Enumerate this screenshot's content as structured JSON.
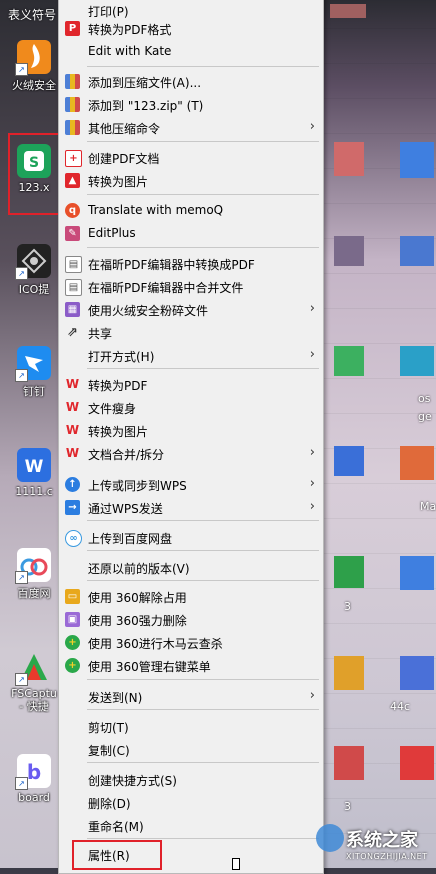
{
  "desktop": {
    "top_label": "表义符号",
    "icons": [
      {
        "label": "火绒安全",
        "icon": "huorong-icon",
        "color": "#f08a1c"
      },
      {
        "label": "123.x",
        "icon": "wps-sheet-icon",
        "color": "#1da35a"
      },
      {
        "label": "ICO提",
        "icon": "ico-tool-icon",
        "color": "#222222"
      },
      {
        "label": "钉钉",
        "icon": "dingtalk-icon",
        "color": "#1e8cf0"
      },
      {
        "label": "1111.c",
        "icon": "wps-writer-icon",
        "color": "#2c6fe0"
      },
      {
        "label": "百度网",
        "icon": "baidu-netdisk-icon",
        "color": "#ffffff"
      },
      {
        "label": "FSCaptu\n- 快捷",
        "icon": "fscapture-icon",
        "color": "#e83a2c"
      },
      {
        "label": "board",
        "icon": "board-icon",
        "color": "#6a5cf0"
      }
    ],
    "right_labels": [
      "os",
      "ge",
      "Ma",
      "3",
      "44c",
      "3"
    ]
  },
  "menu": {
    "items": [
      {
        "label": "打印(P)",
        "icon": "",
        "arrow": false
      },
      {
        "label": "转换为PDF格式",
        "icon": "pdf-convert-icon",
        "color": "#e0262c",
        "arrow": false
      },
      {
        "label": "Edit with Kate",
        "icon": "",
        "arrow": false
      },
      {
        "label": "添加到压缩文件(A)...",
        "icon": "archive-icon",
        "color": "#4d7fd6",
        "arrow": false
      },
      {
        "label": "添加到 \"123.zip\" (T)",
        "icon": "archive-icon",
        "color": "#4d7fd6",
        "arrow": false
      },
      {
        "label": "其他压缩命令",
        "icon": "archive-icon",
        "color": "#4d7fd6",
        "arrow": true
      },
      {
        "label": "创建PDF文档",
        "icon": "pdf-create-icon",
        "color": "#e0262c",
        "arrow": false
      },
      {
        "label": "转换为图片",
        "icon": "image-convert-icon",
        "color": "#e0262c",
        "arrow": false
      },
      {
        "label": "Translate with memoQ",
        "icon": "memoq-icon",
        "color": "#e8502a",
        "arrow": false
      },
      {
        "label": "EditPlus",
        "icon": "editplus-icon",
        "color": "#c94a7a",
        "arrow": false
      },
      {
        "label": "在福昕PDF编辑器中转换成PDF",
        "icon": "foxit-icon",
        "color": "#6a6a6a",
        "arrow": false
      },
      {
        "label": "在福昕PDF编辑器中合并文件",
        "icon": "foxit-icon",
        "color": "#6a6a6a",
        "arrow": false
      },
      {
        "label": "使用火绒安全粉碎文件",
        "icon": "shredder-icon",
        "color": "#8b5cc8",
        "arrow": true
      },
      {
        "label": "共享",
        "icon": "share-icon",
        "color": "#333333",
        "arrow": false
      },
      {
        "label": "打开方式(H)",
        "icon": "",
        "arrow": true
      },
      {
        "label": "转换为PDF",
        "icon": "wps-icon",
        "color": "#e0262c",
        "arrow": false
      },
      {
        "label": "文件瘦身",
        "icon": "wps-icon",
        "color": "#e0262c",
        "arrow": false
      },
      {
        "label": "转换为图片",
        "icon": "wps-icon",
        "color": "#e0262c",
        "arrow": false
      },
      {
        "label": "文档合并/拆分",
        "icon": "wps-icon",
        "color": "#e0262c",
        "arrow": true
      },
      {
        "label": "上传或同步到WPS",
        "icon": "cloud-upload-icon",
        "color": "#2b7de0",
        "arrow": true
      },
      {
        "label": "通过WPS发送",
        "icon": "send-icon",
        "color": "#2b7de0",
        "arrow": true
      },
      {
        "label": "上传到百度网盘",
        "icon": "baidu-netdisk-icon",
        "color": "#3a9ae0",
        "arrow": false
      },
      {
        "label": "还原以前的版本(V)",
        "icon": "",
        "arrow": false
      },
      {
        "label": "使用 360解除占用",
        "icon": "360-unlock-icon",
        "color": "#e8a81c",
        "arrow": false
      },
      {
        "label": "使用 360强力删除",
        "icon": "360-delete-icon",
        "color": "#9a6ad6",
        "arrow": false
      },
      {
        "label": "使用 360进行木马云查杀",
        "icon": "360-scan-icon",
        "color": "#2aa84a",
        "arrow": false
      },
      {
        "label": "使用 360管理右键菜单",
        "icon": "360-menu-icon",
        "color": "#2aa84a",
        "arrow": false
      },
      {
        "label": "发送到(N)",
        "icon": "",
        "arrow": true
      },
      {
        "label": "剪切(T)",
        "icon": "",
        "arrow": false
      },
      {
        "label": "复制(C)",
        "icon": "",
        "arrow": false
      },
      {
        "label": "创建快捷方式(S)",
        "icon": "",
        "arrow": false
      },
      {
        "label": "删除(D)",
        "icon": "",
        "arrow": false
      },
      {
        "label": "重命名(M)",
        "icon": "",
        "arrow": false
      },
      {
        "label": "属性(R)",
        "icon": "",
        "arrow": false
      }
    ],
    "arrow_glyph": "›"
  },
  "watermark": {
    "text": "系统之家",
    "url": "XITONGZHIJIA.NET"
  },
  "colors": {
    "highlight": "#e0212a",
    "menu_bg": "#f0f0f0"
  }
}
